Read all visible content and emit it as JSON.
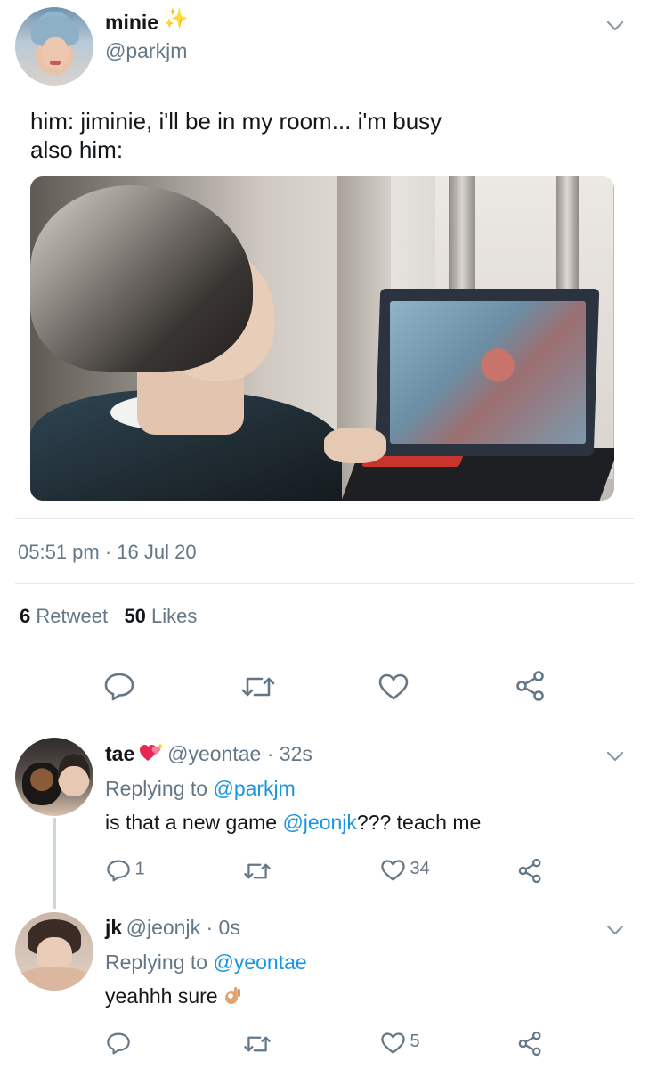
{
  "main_tweet": {
    "display_name": "minie",
    "name_emoji": "✨",
    "handle": "@parkjm",
    "text_line1": "him: jiminie, i'll be in my room... i'm busy",
    "text_line2": "also him:",
    "timestamp": "05:51 pm · 16 Jul 20",
    "retweet_count": "6",
    "retweet_label": "Retweet",
    "like_count": "50",
    "like_label": "Likes"
  },
  "replies": [
    {
      "display_name": "tae",
      "handle_time": "@yeontae · 32s",
      "replying_prefix": "Replying to",
      "replying_to": "@parkjm",
      "body_before": "is that a new game ",
      "body_mention": "@jeonjk",
      "body_after": "??? teach me",
      "reply_count": "1",
      "like_count": "34"
    },
    {
      "display_name": "jk",
      "handle_time": "@jeonjk · 0s",
      "replying_prefix": "Replying to",
      "replying_to": "@yeontae",
      "body": "yeahhh sure",
      "reply_count": "",
      "like_count": "5"
    }
  ],
  "colors": {
    "link": "#1b95e0",
    "muted": "#657786",
    "divider": "#e1e8ed"
  }
}
